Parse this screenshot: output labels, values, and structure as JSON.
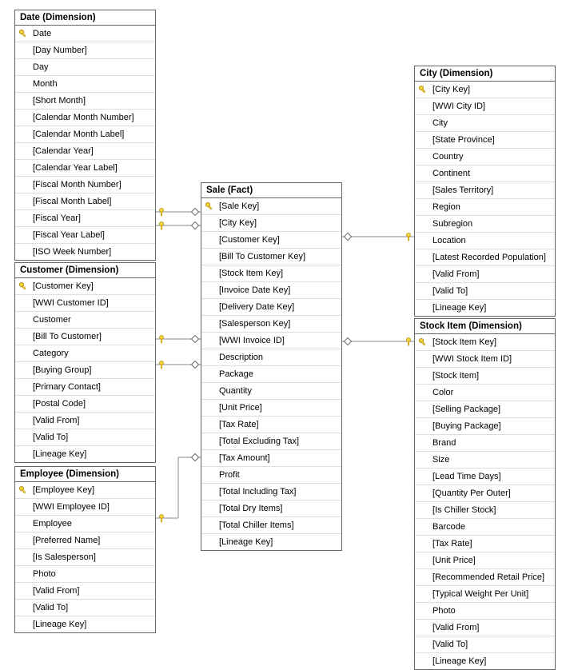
{
  "tables": {
    "date": {
      "title": "Date (Dimension)",
      "fields": [
        {
          "label": "Date",
          "pk": true
        },
        {
          "label": "[Day Number]"
        },
        {
          "label": "Day"
        },
        {
          "label": "Month"
        },
        {
          "label": "[Short Month]"
        },
        {
          "label": "[Calendar Month Number]"
        },
        {
          "label": "[Calendar Month Label]"
        },
        {
          "label": "[Calendar Year]"
        },
        {
          "label": "[Calendar Year Label]"
        },
        {
          "label": "[Fiscal Month Number]"
        },
        {
          "label": "[Fiscal Month Label]"
        },
        {
          "label": "[Fiscal Year]"
        },
        {
          "label": "[Fiscal Year Label]"
        },
        {
          "label": "[ISO Week Number]"
        }
      ]
    },
    "customer": {
      "title": "Customer (Dimension)",
      "fields": [
        {
          "label": "[Customer Key]",
          "pk": true
        },
        {
          "label": "[WWI Customer ID]"
        },
        {
          "label": "Customer"
        },
        {
          "label": "[Bill To Customer]"
        },
        {
          "label": "Category"
        },
        {
          "label": "[Buying Group]"
        },
        {
          "label": "[Primary Contact]"
        },
        {
          "label": "[Postal Code]"
        },
        {
          "label": "[Valid From]"
        },
        {
          "label": "[Valid To]"
        },
        {
          "label": "[Lineage Key]"
        }
      ]
    },
    "employee": {
      "title": "Employee (Dimension)",
      "fields": [
        {
          "label": "[Employee Key]",
          "pk": true
        },
        {
          "label": "[WWI Employee ID]"
        },
        {
          "label": "Employee"
        },
        {
          "label": "[Preferred Name]"
        },
        {
          "label": "[Is Salesperson]"
        },
        {
          "label": "Photo"
        },
        {
          "label": "[Valid From]"
        },
        {
          "label": "[Valid To]"
        },
        {
          "label": "[Lineage Key]"
        }
      ]
    },
    "sale": {
      "title": "Sale (Fact)",
      "fields": [
        {
          "label": "[Sale Key]",
          "pk": true
        },
        {
          "label": "[City Key]"
        },
        {
          "label": "[Customer Key]"
        },
        {
          "label": "[Bill To Customer Key]"
        },
        {
          "label": "[Stock Item Key]"
        },
        {
          "label": "[Invoice Date Key]"
        },
        {
          "label": "[Delivery Date Key]"
        },
        {
          "label": "[Salesperson Key]"
        },
        {
          "label": "[WWI Invoice ID]"
        },
        {
          "label": "Description"
        },
        {
          "label": "Package"
        },
        {
          "label": "Quantity"
        },
        {
          "label": "[Unit Price]"
        },
        {
          "label": "[Tax Rate]"
        },
        {
          "label": "[Total Excluding Tax]"
        },
        {
          "label": "[Tax Amount]"
        },
        {
          "label": "Profit"
        },
        {
          "label": "[Total Including Tax]"
        },
        {
          "label": "[Total Dry Items]"
        },
        {
          "label": "[Total Chiller Items]"
        },
        {
          "label": "[Lineage Key]"
        }
      ]
    },
    "city": {
      "title": "City (Dimension)",
      "fields": [
        {
          "label": "[City Key]",
          "pk": true
        },
        {
          "label": "[WWI City ID]"
        },
        {
          "label": "City"
        },
        {
          "label": "[State Province]"
        },
        {
          "label": "Country"
        },
        {
          "label": "Continent"
        },
        {
          "label": "[Sales Territory]"
        },
        {
          "label": "Region"
        },
        {
          "label": "Subregion"
        },
        {
          "label": "Location"
        },
        {
          "label": "[Latest Recorded Population]"
        },
        {
          "label": "[Valid From]"
        },
        {
          "label": "[Valid To]"
        },
        {
          "label": "[Lineage Key]"
        }
      ]
    },
    "stockitem": {
      "title": "Stock Item (Dimension)",
      "fields": [
        {
          "label": "[Stock Item Key]",
          "pk": true
        },
        {
          "label": "[WWI Stock Item ID]"
        },
        {
          "label": "[Stock Item]"
        },
        {
          "label": "Color"
        },
        {
          "label": "[Selling Package]"
        },
        {
          "label": "[Buying Package]"
        },
        {
          "label": "Brand"
        },
        {
          "label": "Size"
        },
        {
          "label": "[Lead Time Days]"
        },
        {
          "label": "[Quantity Per Outer]"
        },
        {
          "label": "[Is Chiller Stock]"
        },
        {
          "label": "Barcode"
        },
        {
          "label": "[Tax Rate]"
        },
        {
          "label": "[Unit Price]"
        },
        {
          "label": "[Recommended Retail Price]"
        },
        {
          "label": "[Typical Weight Per Unit]"
        },
        {
          "label": "Photo"
        },
        {
          "label": "[Valid From]"
        },
        {
          "label": "[Valid To]"
        },
        {
          "label": "[Lineage Key]"
        }
      ]
    }
  }
}
